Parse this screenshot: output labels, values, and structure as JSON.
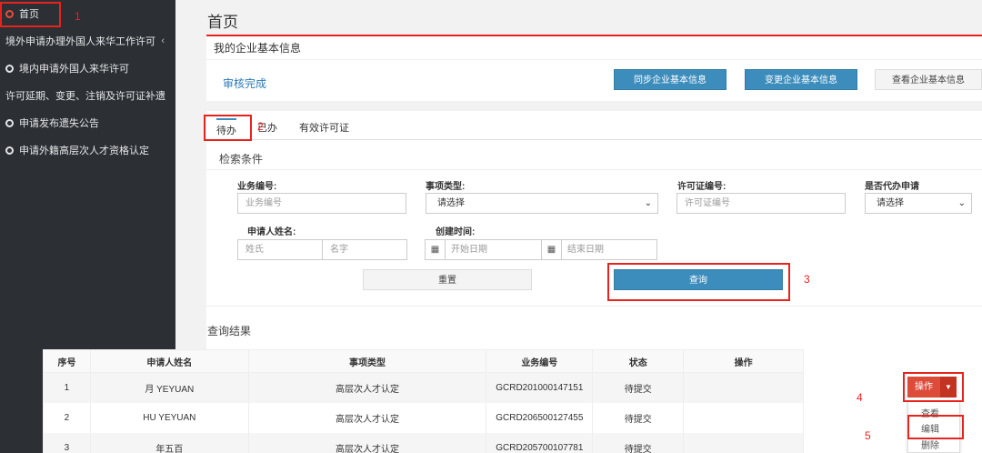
{
  "sidebar": {
    "items": [
      {
        "label": "首页",
        "type": "item",
        "active": true
      },
      {
        "label": "境外申请办理外国人来华工作许可",
        "type": "group",
        "chevron": "‹"
      },
      {
        "label": "境内申请外国人来华许可",
        "type": "item"
      },
      {
        "label": "许可延期、变更、注销及许可证补遗",
        "type": "group",
        "chevron": "‹"
      },
      {
        "label": "申请发布遗失公告",
        "type": "item"
      },
      {
        "label": "申请外籍高层次人才资格认定",
        "type": "item"
      }
    ]
  },
  "page": {
    "title": "首页"
  },
  "enterprise": {
    "heading": "我的企业基本信息",
    "status": "审核完成",
    "buttons": {
      "sync": "同步企业基本信息",
      "change": "变更企业基本信息",
      "view": "查看企业基本信息"
    }
  },
  "tabs": [
    "待办",
    "已办",
    "有效许可证"
  ],
  "search": {
    "title": "检索条件",
    "fields": {
      "business_no_label": "业务编号:",
      "business_no_placeholder": "业务编号",
      "item_type_label": "事项类型:",
      "item_type_value": "请选择",
      "license_no_label": "许可证编号:",
      "license_no_placeholder": "许可证编号",
      "proxy_label": "是否代办申请",
      "proxy_value": "请选择",
      "applicant_label": "申请人姓名:",
      "surname_placeholder": "姓氏",
      "given_name_placeholder": "名字",
      "created_label": "创建时间:",
      "start_placeholder": "开始日期",
      "end_placeholder": "结束日期"
    },
    "reset": "重置",
    "query": "查询"
  },
  "results": {
    "title": "查询结果",
    "headers": [
      "序号",
      "申请人姓名",
      "事项类型",
      "业务编号",
      "状态",
      "操作"
    ],
    "rows": [
      [
        "1",
        "月 YEYUAN",
        "高层次人才认定",
        "GCRD201000147151",
        "待提交"
      ],
      [
        "2",
        "HU YEYUAN",
        "高层次人才认定",
        "GCRD206500127455",
        "待提交"
      ],
      [
        "3",
        "年五百",
        "高层次人才认定",
        "GCRD205700107781",
        "待提交"
      ]
    ],
    "op_button": "操作",
    "dropdown": [
      "查看",
      "编辑",
      "删除"
    ]
  },
  "annotations": [
    "1",
    "2",
    "3",
    "4",
    "5"
  ],
  "colors": {
    "sidebar_bg": "#2c3035",
    "primary": "#3c8dbc",
    "danger": "#dd4b39",
    "annotation": "#e8231f"
  }
}
